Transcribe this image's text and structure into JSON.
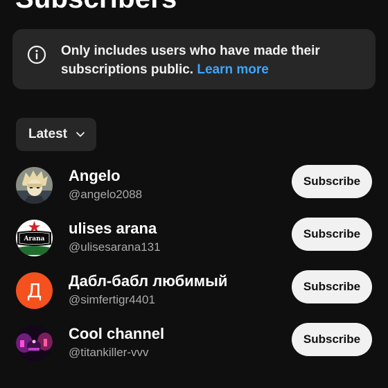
{
  "header": {
    "title": "Subscribers"
  },
  "info": {
    "text": "Only includes users who have made their subscriptions public.",
    "link": "Learn more",
    "icon": "info-icon"
  },
  "sort": {
    "label": "Latest",
    "icon": "chevron-down-icon"
  },
  "subscribers": [
    {
      "name": "Angelo",
      "handle": "@angelo2088",
      "button": "Subscribe"
    },
    {
      "name": "ulises arana",
      "handle": "@ulisesarana131",
      "avatar_text": "Arana",
      "button": "Subscribe"
    },
    {
      "name": "Дабл-бабл любимый",
      "handle": "@simfertigr4401",
      "avatar_letter": "Д",
      "avatar_color": "#f4511e",
      "button": "Subscribe"
    },
    {
      "name": "Cool channel",
      "handle": "@titankiller-vvv",
      "button": "Subscribe"
    }
  ],
  "colors": {
    "background": "#0f0f0f",
    "card": "#272727",
    "link": "#3ea6ff",
    "button_bg": "#f1f1f1",
    "secondary_text": "#aaaaaa"
  }
}
